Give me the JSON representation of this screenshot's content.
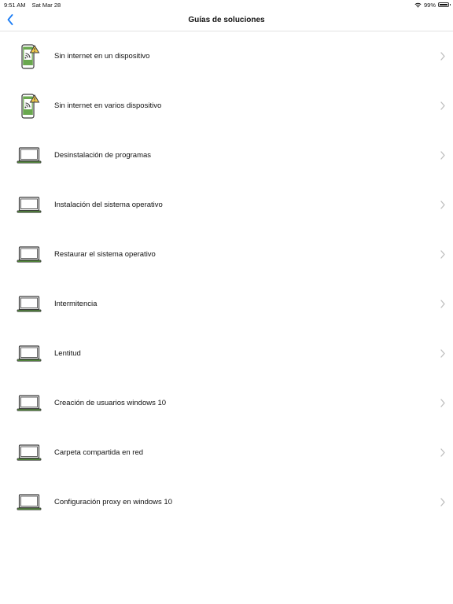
{
  "status_bar": {
    "time": "9:51 AM",
    "date": "Sat Mar 28",
    "battery": "99%",
    "battery_level": 0.99
  },
  "nav": {
    "title": "Guías de soluciones",
    "back_icon": "chevron-left-icon"
  },
  "colors": {
    "accent": "#1a7cf5",
    "icon_green": "#5a9e3c",
    "warning_yellow": "#f2c94c"
  },
  "items": [
    {
      "label": "Sin internet en un dispositivo",
      "icon": "phone-no-internet-icon"
    },
    {
      "label": "Sin internet en varios dispositivo",
      "icon": "phone-no-internet-icon"
    },
    {
      "label": "Desinstalación de programas",
      "icon": "laptop-icon"
    },
    {
      "label": "Instalación del sistema operativo",
      "icon": "laptop-icon"
    },
    {
      "label": "Restaurar el sistema operativo",
      "icon": "laptop-icon"
    },
    {
      "label": "Intermitencia",
      "icon": "laptop-icon"
    },
    {
      "label": "Lentitud",
      "icon": "laptop-icon"
    },
    {
      "label": "Creación de usuarios windows 10",
      "icon": "laptop-icon"
    },
    {
      "label": "Carpeta compartida en red",
      "icon": "laptop-icon"
    },
    {
      "label": "Configuración proxy en windows 10",
      "icon": "laptop-icon"
    }
  ]
}
